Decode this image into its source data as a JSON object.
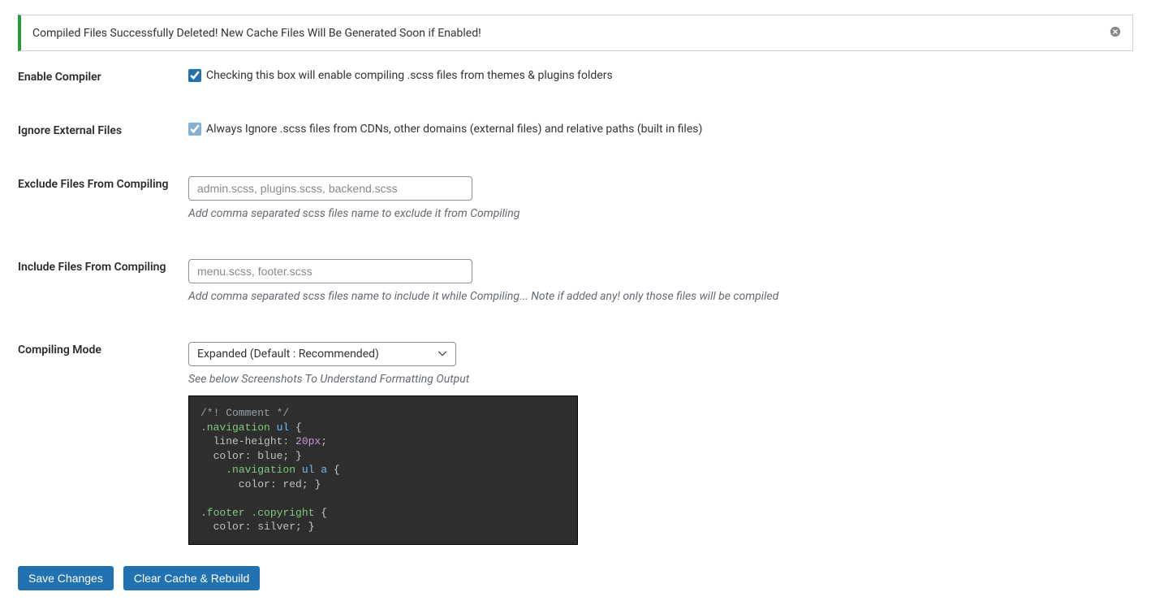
{
  "notice": {
    "message": "Compiled Files Successfully Deleted! New Cache Files Will Be Generated Soon if Enabled!",
    "close_icon": "✖"
  },
  "fields": {
    "enable_compiler": {
      "label": "Enable Compiler",
      "checkbox_text": "Checking this box will enable compiling .scss files from themes & plugins folders",
      "checked": true
    },
    "ignore_external": {
      "label": "Ignore External Files",
      "checkbox_text": "Always Ignore .scss files from CDNs, other domains (external files) and relative paths (built in files)",
      "checked": true
    },
    "exclude": {
      "label": "Exclude Files From Compiling",
      "placeholder": "admin.scss, plugins.scss, backend.scss",
      "value": "",
      "help": "Add comma separated scss files name to exclude it from Compiling"
    },
    "include": {
      "label": "Include Files From Compiling",
      "placeholder": "menu.scss, footer.scss",
      "value": "",
      "help": "Add comma separated scss files name to include it while Compiling... Note if added any! only those files will be compiled"
    },
    "mode": {
      "label": "Compiling Mode",
      "selected": "Expanded (Default : Recommended)",
      "help": "See below Screenshots To Understand Formatting Output"
    }
  },
  "code": {
    "l1_com": "/*! Comment */",
    "l2_sel": ".navigation",
    "l2_tag": " ul ",
    "l2_brace": "{",
    "l3_prop": "  line-height:",
    "l3_num": " 20px",
    "l3_end": ";",
    "l4_prop": "  color:",
    "l4_val": " blue;",
    "l4_brace": " }",
    "l5_indent": "    ",
    "l5_sel": ".navigation",
    "l5_tag": " ul a ",
    "l5_brace": "{",
    "l6_prop": "      color:",
    "l6_val": " red;",
    "l6_brace": " }",
    "l8_sel": ".footer .copyright ",
    "l8_brace": "{",
    "l9_prop": "  color:",
    "l9_val": " silver;",
    "l9_brace": " }"
  },
  "actions": {
    "save": "Save Changes",
    "clear": "Clear Cache & Rebuild"
  }
}
